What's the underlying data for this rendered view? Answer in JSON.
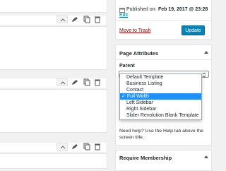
{
  "publish": {
    "published_label": "Published on:",
    "published_date": "Feb 19, 2017 @ 23:28",
    "edit_link": "Edit",
    "trash_link": "Move to Trash",
    "update_button": "Update"
  },
  "page_attributes": {
    "title": "Page Attributes",
    "parent_label": "Parent",
    "template_options": [
      "Default Template",
      "Business Listing",
      "Contact",
      "Full Width",
      "Left Sidebar",
      "Right Sidebar",
      "Slider Revolution Blank Template"
    ],
    "selected_template": "Full Width",
    "help_text_line1": "Need help? Use the Help tab above the",
    "help_text_line2": "screen title."
  },
  "membership": {
    "title": "Require Membership"
  },
  "icons": {
    "toggle": "caret-up-icon",
    "calendar": "calendar-icon",
    "pencil": "pencil-icon",
    "copy": "copy-icon",
    "trash": "trash-icon",
    "checkmark": "checkmark-icon"
  },
  "colors": {
    "accent": "#0085ba",
    "link": "#0073aa",
    "danger": "#a00000",
    "selection": "#1e90ff"
  }
}
